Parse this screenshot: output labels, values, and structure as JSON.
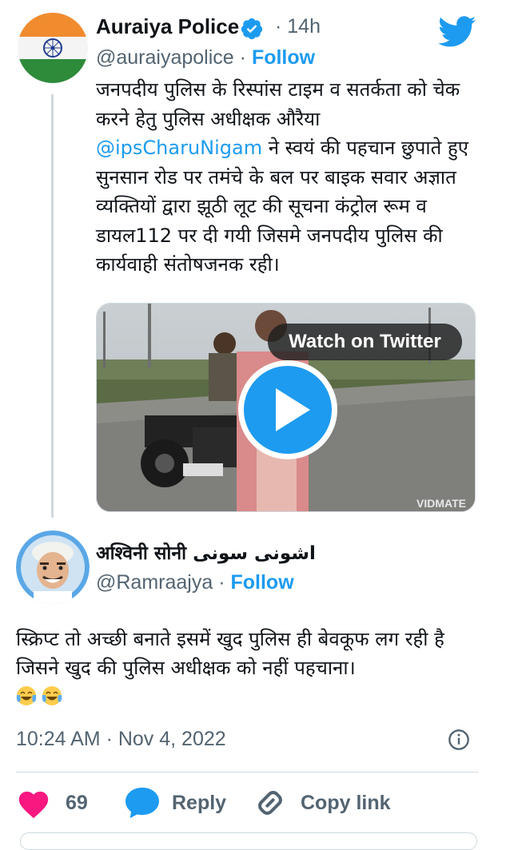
{
  "tweet": {
    "author_name": "Auraiya Police",
    "time": "14h",
    "handle": "@auraiyapolice",
    "separator": "·",
    "follow_label": "Follow",
    "text_part1": "जनपदीय पुलिस के रिस्पांस टाइम व सतर्कता को चेक करने हेतु पुलिस अधीक्षक औरैया ",
    "mention": "@ipsCharuNigam",
    "text_part2": " ने स्वयं की पहचान छुपाते हुए सुनसान रोड पर तमंचे के बल पर बाइक सवार अज्ञात व्यक्तियों द्वारा झूठी लूट की सूचना कंट्रोल रूम व डायल112 पर दी गयी जिसमे जनपदीय पुलिस की कार्यवाही संतोषजनक रही।",
    "watch_label": "Watch on Twitter",
    "media_watermark": "VIDMATE"
  },
  "reply": {
    "author_name": "अश्विनी सोनी اشونی سونی",
    "handle": "@Ramraajya",
    "separator": "·",
    "follow_label": "Follow",
    "text": "स्क्रिप्ट तो अच्छी बनाते इसमें खुद पुलिस ही बेवकूफ लग रही है जिसने खुद की पुलिस अधीक्षक को नहीं पहचाना।",
    "emoji": [
      "face-with-tears-of-joy",
      "face-with-tears-of-joy"
    ]
  },
  "meta": {
    "timestamp": "10:24 AM · Nov 4, 2022"
  },
  "actions": {
    "like_count": "69",
    "reply_label": "Reply",
    "copy_label": "Copy link"
  },
  "icons": [
    "verified-badge-icon",
    "twitter-bird-icon",
    "play-icon",
    "info-icon",
    "heart-icon",
    "reply-bubble-icon",
    "link-icon"
  ],
  "colors": {
    "accent": "#1d9bf0",
    "like": "#f91880",
    "muted": "#536471",
    "border": "#cfd9de"
  }
}
